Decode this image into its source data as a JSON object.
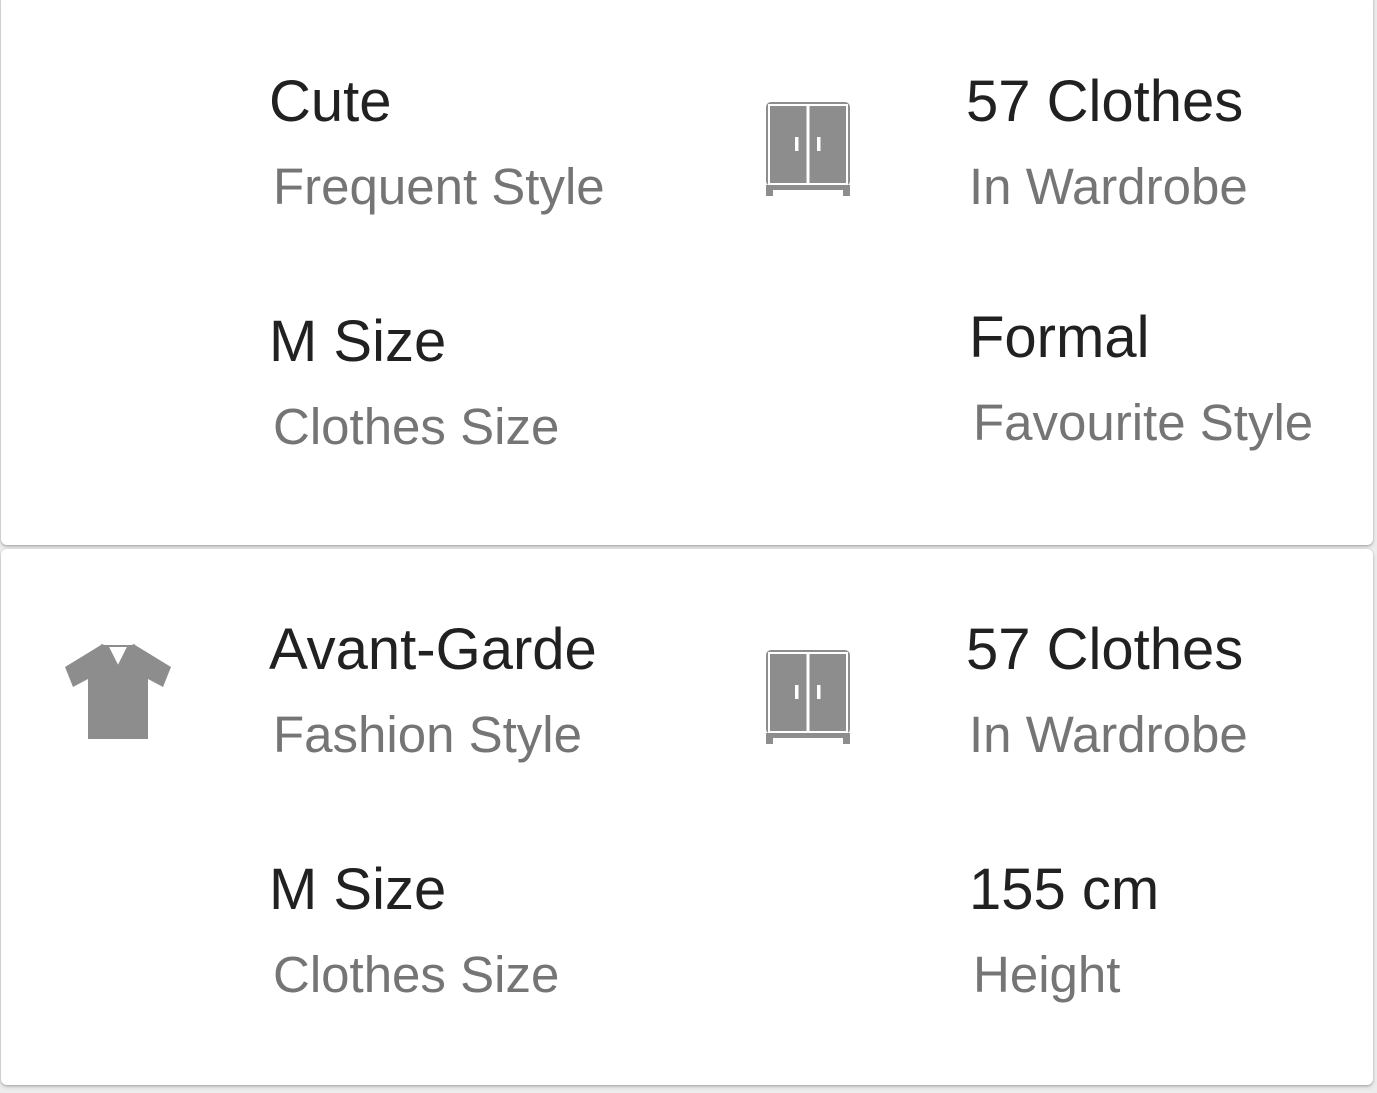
{
  "cards": [
    {
      "stats": [
        {
          "title": "Cute",
          "subtitle": "Frequent Style"
        },
        {
          "title": "57 Clothes",
          "subtitle": "In Wardrobe",
          "icon": "wardrobe-icon"
        },
        {
          "title": "M Size",
          "subtitle": "Clothes Size"
        },
        {
          "title": "Formal",
          "subtitle": "Favourite Style"
        }
      ]
    },
    {
      "stats": [
        {
          "title": "Avant-Garde",
          "subtitle": "Fashion Style",
          "icon": "shirt-icon"
        },
        {
          "title": "57 Clothes",
          "subtitle": "In Wardrobe",
          "icon": "wardrobe-icon"
        },
        {
          "title": "M Size",
          "subtitle": "Clothes Size"
        },
        {
          "title": "155 cm",
          "subtitle": "Height"
        }
      ]
    }
  ],
  "colors": {
    "title": "#212121",
    "subtitle": "#757575",
    "icon": "#8d8d8d",
    "card": "#ffffff",
    "background": "#ececec"
  }
}
